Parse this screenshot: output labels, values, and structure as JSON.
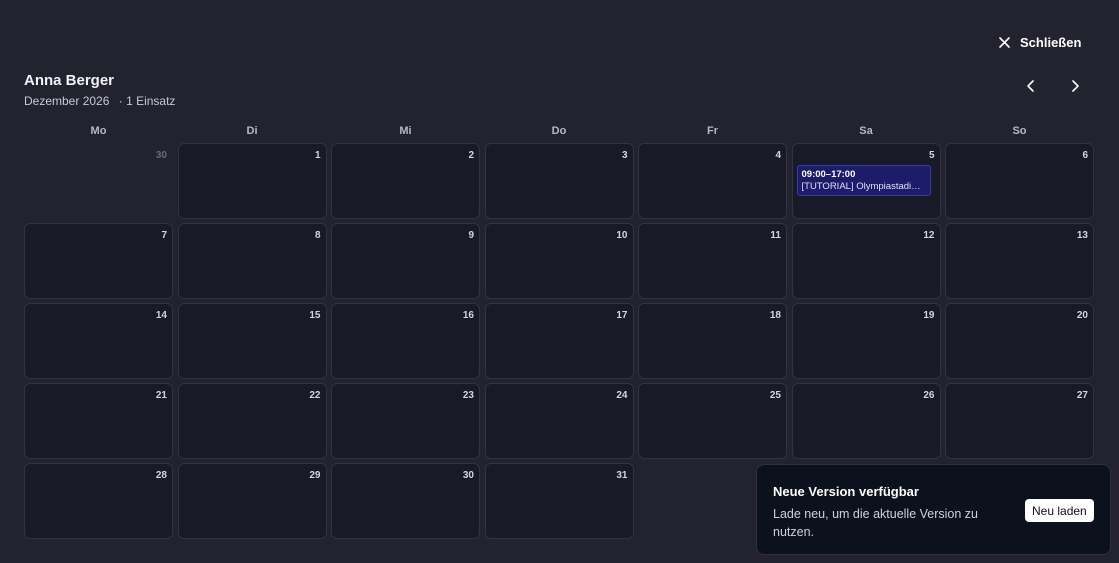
{
  "close_label": "Schließen",
  "person_name": "Anna Berger",
  "month_label": "Dezember 2026",
  "count_label": "· 1 Einsatz",
  "weekdays": [
    "Mo",
    "Di",
    "Mi",
    "Do",
    "Fr",
    "Sa",
    "So"
  ],
  "weeks": [
    [
      {
        "day": "30",
        "outside": true
      },
      {
        "day": "1"
      },
      {
        "day": "2"
      },
      {
        "day": "3"
      },
      {
        "day": "4"
      },
      {
        "day": "5",
        "event": {
          "time": "09:00–17:00",
          "title": "[TUTORIAL] Olympiastadion Berlin"
        }
      },
      {
        "day": "6"
      }
    ],
    [
      {
        "day": "7"
      },
      {
        "day": "8"
      },
      {
        "day": "9"
      },
      {
        "day": "10"
      },
      {
        "day": "11"
      },
      {
        "day": "12"
      },
      {
        "day": "13"
      }
    ],
    [
      {
        "day": "14"
      },
      {
        "day": "15"
      },
      {
        "day": "16"
      },
      {
        "day": "17"
      },
      {
        "day": "18"
      },
      {
        "day": "19"
      },
      {
        "day": "20"
      }
    ],
    [
      {
        "day": "21"
      },
      {
        "day": "22"
      },
      {
        "day": "23"
      },
      {
        "day": "24"
      },
      {
        "day": "25"
      },
      {
        "day": "26"
      },
      {
        "day": "27"
      }
    ],
    [
      {
        "day": "28"
      },
      {
        "day": "29"
      },
      {
        "day": "30"
      },
      {
        "day": "31"
      },
      {
        "day": ""
      },
      {
        "day": ""
      },
      {
        "day": ""
      }
    ]
  ],
  "toast": {
    "title": "Neue Version verfügbar",
    "message": "Lade neu, um die aktuelle Version zu nutzen.",
    "button": "Neu laden"
  },
  "colors": {
    "background": "#23222f",
    "cell": "#181b27",
    "event": "#1d1c6b",
    "toast": "#0c111e"
  },
  "icons": {
    "close": "close-icon",
    "prev": "chevron-left-icon",
    "next": "chevron-right-icon"
  }
}
